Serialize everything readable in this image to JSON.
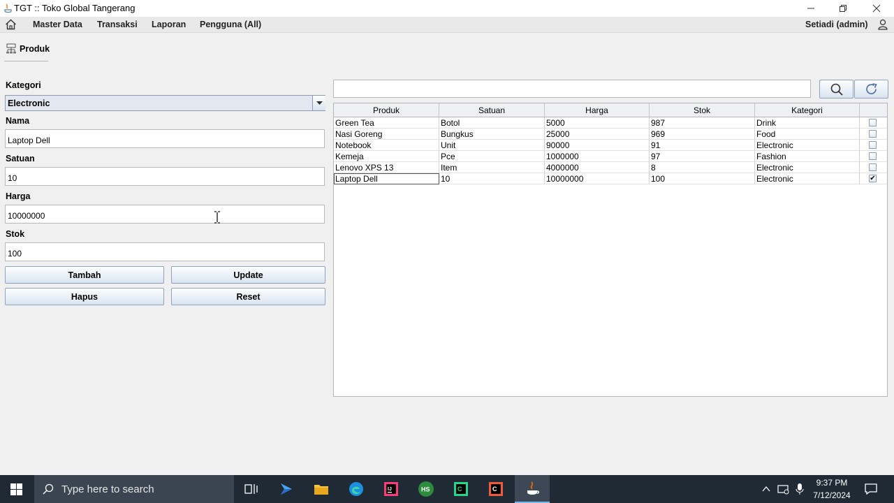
{
  "window": {
    "title": "TGT :: Toko Global Tangerang"
  },
  "menu": {
    "items": [
      "Master Data",
      "Transaksi",
      "Laporan",
      "Pengguna (All)"
    ],
    "user": "Setiadi (admin)"
  },
  "panel": {
    "title": "Produk"
  },
  "form": {
    "kategori_label": "Kategori",
    "kategori_value": "Electronic",
    "nama_label": "Nama",
    "nama_value": "Laptop Dell",
    "satuan_label": "Satuan",
    "satuan_value": "10",
    "harga_label": "Harga",
    "harga_value": "10000000",
    "stok_label": "Stok",
    "stok_value": "100",
    "buttons": {
      "tambah": "Tambah",
      "update": "Update",
      "hapus": "Hapus",
      "reset": "Reset"
    }
  },
  "search": {
    "value": ""
  },
  "table": {
    "columns": [
      "Produk",
      "Satuan",
      "Harga",
      "Stok",
      "Kategori",
      ""
    ],
    "rows": [
      {
        "produk": "Green Tea",
        "satuan": "Botol",
        "harga": "5000",
        "stok": "987",
        "kategori": "Drink",
        "checked": false
      },
      {
        "produk": "Nasi Goreng",
        "satuan": "Bungkus",
        "harga": "25000",
        "stok": "969",
        "kategori": "Food",
        "checked": false
      },
      {
        "produk": "Notebook",
        "satuan": "Unit",
        "harga": "90000",
        "stok": "91",
        "kategori": "Electronic",
        "checked": false
      },
      {
        "produk": "Kemeja",
        "satuan": "Pce",
        "harga": "1000000",
        "stok": "97",
        "kategori": "Fashion",
        "checked": false
      },
      {
        "produk": "Lenovo XPS 13",
        "satuan": "Item",
        "harga": "4000000",
        "stok": "8",
        "kategori": "Electronic",
        "checked": false
      },
      {
        "produk": "Laptop Dell",
        "satuan": "10",
        "harga": "10000000",
        "stok": "100",
        "kategori": "Electronic",
        "checked": true
      }
    ]
  },
  "taskbar": {
    "search_placeholder": "Type here to search",
    "time": "9:37 PM",
    "date": "7/12/2024",
    "apps": [
      "task-view-icon",
      "power-automate-icon",
      "file-explorer-icon",
      "edge-icon",
      "intellij-icon",
      "hs-app-icon",
      "pycharm-ce-icon",
      "clion-icon",
      "java-icon"
    ]
  },
  "colors": {
    "accent": "#2f5f9e",
    "taskbar": "#1f2a35",
    "button_top": "#fdfeff",
    "button_bottom": "#d9e4f1"
  }
}
